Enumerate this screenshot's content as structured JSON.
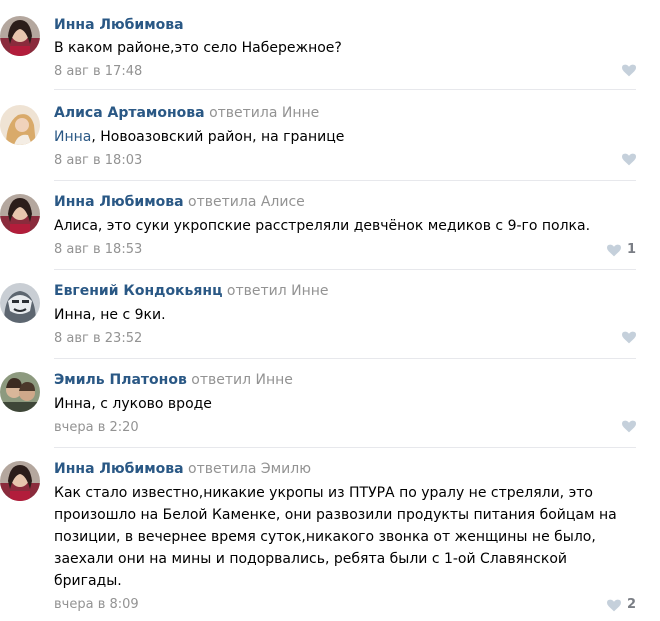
{
  "comments": [
    {
      "author": "Инна Любимова",
      "reply_to": "",
      "mention": "",
      "text": "В каком районе,это село Набережное?",
      "date": "8 авг в 17:48",
      "likes": ""
    },
    {
      "author": "Алиса Артамонова",
      "reply_to": "ответила Инне",
      "mention": "Инна",
      "text": ", Новоазовский район, на границе",
      "date": "8 авг в 18:03",
      "likes": ""
    },
    {
      "author": "Инна Любимова",
      "reply_to": "ответила Алисе",
      "mention": "",
      "text": "Алиса, это суки укропские расстреляли девчёнок медиков с 9-го полка.",
      "date": "8 авг в 18:53",
      "likes": "1"
    },
    {
      "author": "Евгений Кондокьянц",
      "reply_to": "ответил Инне",
      "mention": "",
      "text": "Инна, не с 9ки.",
      "date": "8 авг в 23:52",
      "likes": ""
    },
    {
      "author": "Эмиль Платонов",
      "reply_to": "ответил Инне",
      "mention": "",
      "text": "Инна, с луково вроде",
      "date": "вчера в 2:20",
      "likes": ""
    },
    {
      "author": "Инна Любимова",
      "reply_to": "ответила Эмилю",
      "mention": "",
      "text": "Как стало известно,никакие укропы из ПТУРА по уралу не стреляли, это произошло на Белой Каменке, они развозили продукты питания бойцам на позиции, в вечернее время суток,никакого звонка от женщины не было, заехали они на мины и подорвались, ребята были с 1-ой Славянской бригады.",
      "date": "вчера в 8:09",
      "likes": "2"
    }
  ],
  "icons": {
    "like": "heart-icon"
  },
  "colors": {
    "author": "#2a5885",
    "secondary": "#939393",
    "divider": "#e7e8ec",
    "heart": "#c5d0db"
  }
}
